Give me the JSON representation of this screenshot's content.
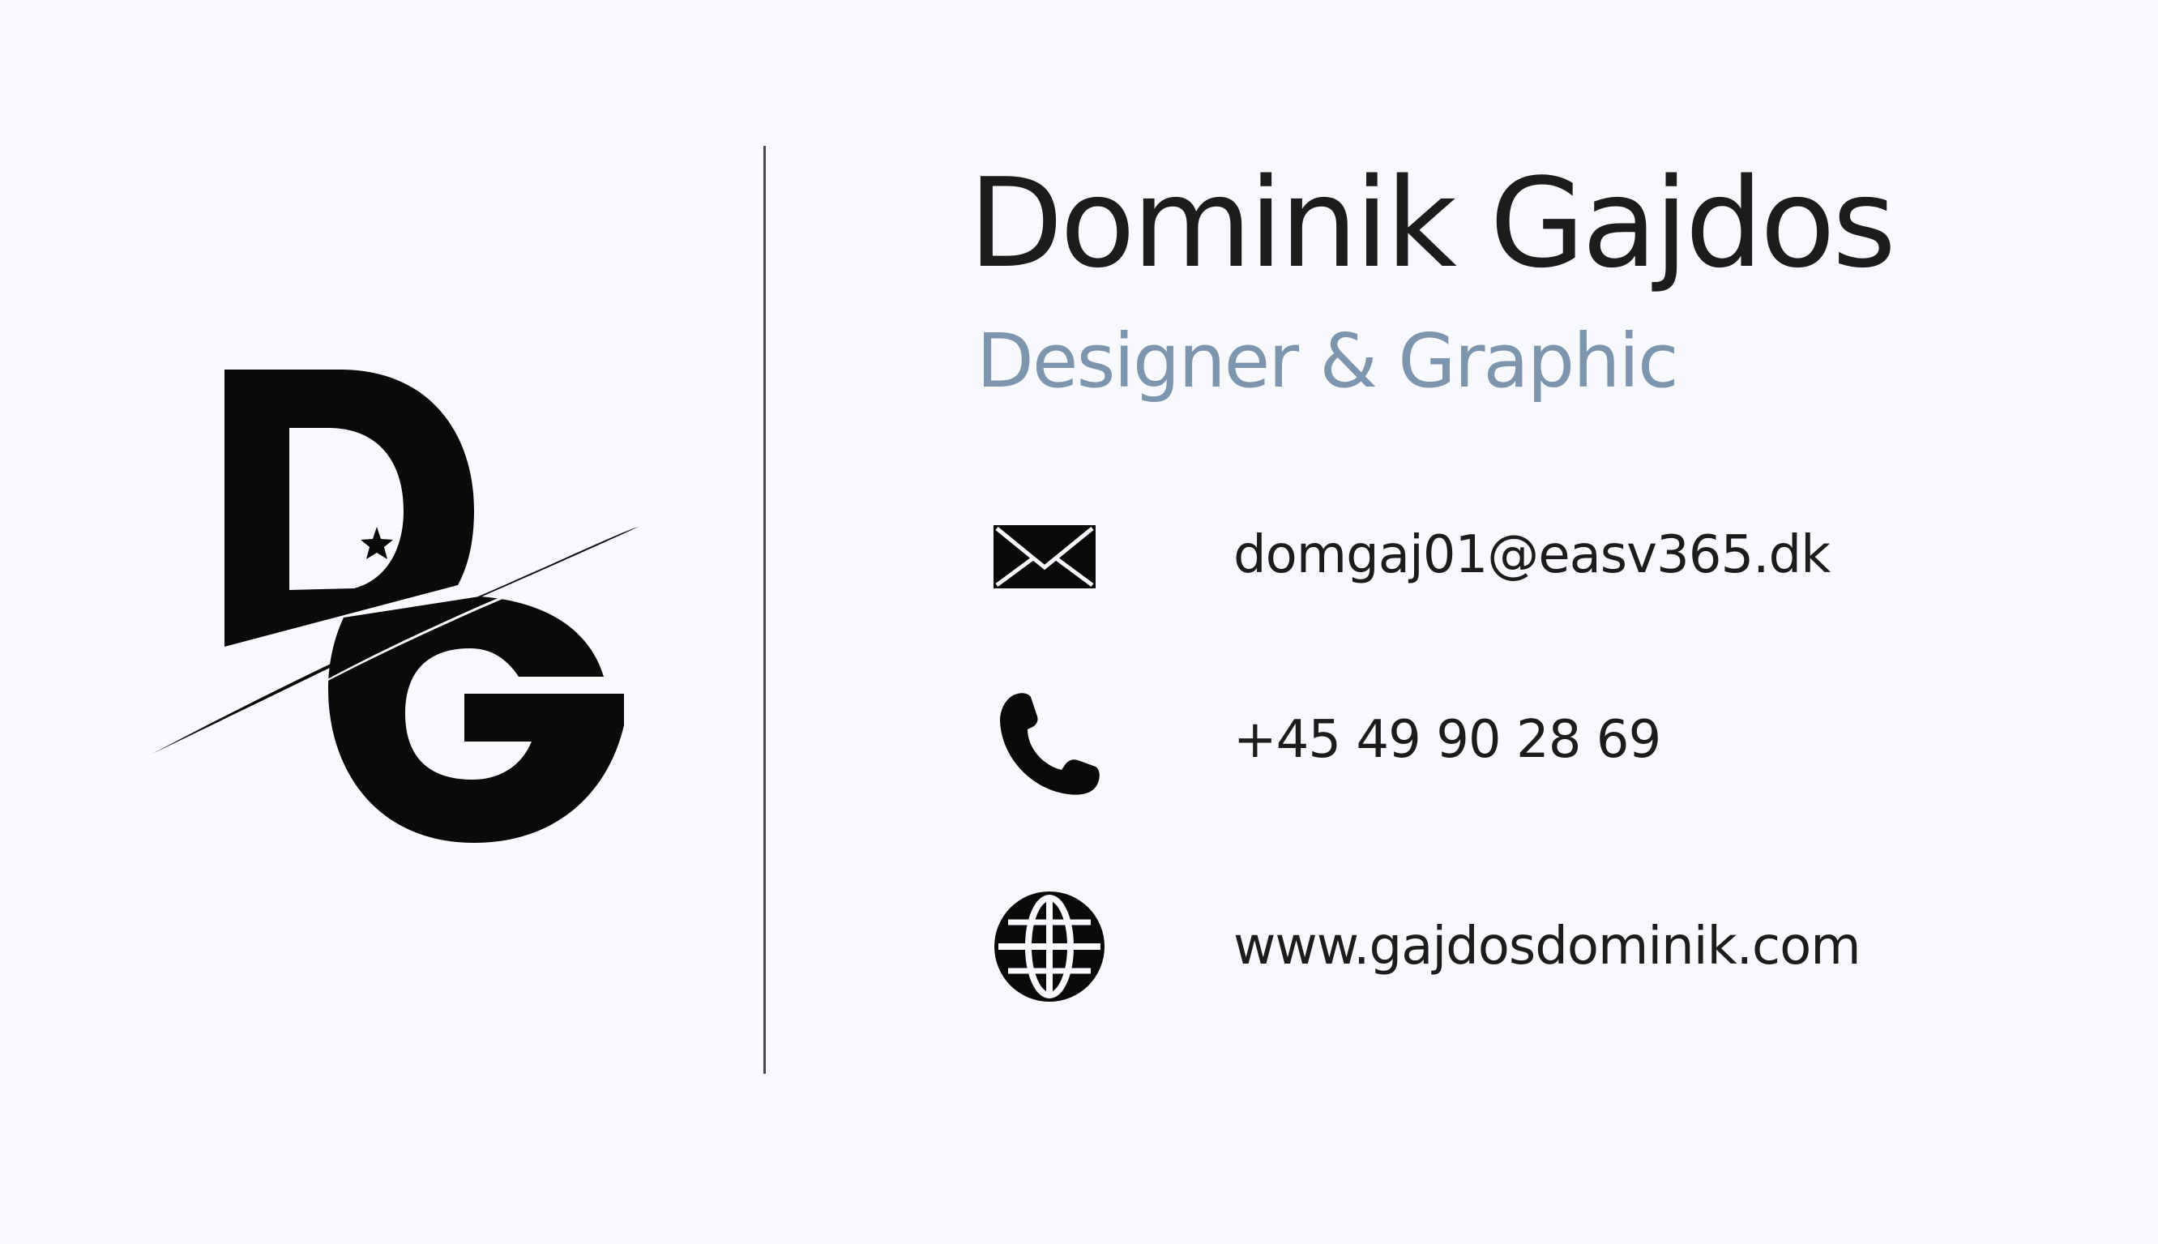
{
  "card": {
    "name": "Dominik Gajdos",
    "title": "Designer & Graphic",
    "logo": {
      "letters": "DG",
      "icon": "dg-monogram-logo",
      "color": "#0a0a0a"
    },
    "contacts": [
      {
        "type": "email",
        "icon": "envelope-icon",
        "text": "domgaj01@easv365.dk"
      },
      {
        "type": "phone",
        "icon": "phone-icon",
        "text": "+45 49 90 28 69"
      },
      {
        "type": "website",
        "icon": "globe-icon",
        "text": "www.gajdosdominik.com"
      }
    ]
  },
  "colors": {
    "background": "#f7f9fc",
    "text": "#1c1c1c",
    "accent": "#7d95ad",
    "divider": "#4a4a4a"
  }
}
